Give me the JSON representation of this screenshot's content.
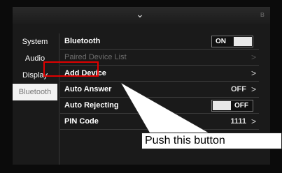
{
  "topbar": {
    "chevron": "⌄",
    "status_icon": "bluetooth-indicator-icon",
    "status_glyph": "ʙ"
  },
  "sidebar": {
    "items": [
      {
        "label": "System",
        "active": false
      },
      {
        "label": "Audio",
        "active": false
      },
      {
        "label": "Display",
        "active": false
      },
      {
        "label": "Bluetooth",
        "active": true
      }
    ]
  },
  "rows": {
    "bluetooth": {
      "label": "Bluetooth",
      "toggle": "ON"
    },
    "paired": {
      "label": "Paired Device List",
      "arrow": ">"
    },
    "add_device": {
      "label": "Add Device",
      "arrow": ">"
    },
    "auto_answer": {
      "label": "Auto Answer",
      "value": "OFF",
      "arrow": ">"
    },
    "auto_rejecting": {
      "label": "Auto Rejecting",
      "toggle": "OFF"
    },
    "pin_code": {
      "label": "PIN Code",
      "value": "1111",
      "arrow": ">"
    }
  },
  "annotation": {
    "text": "Push this button",
    "highlight_color": "#e00000"
  }
}
